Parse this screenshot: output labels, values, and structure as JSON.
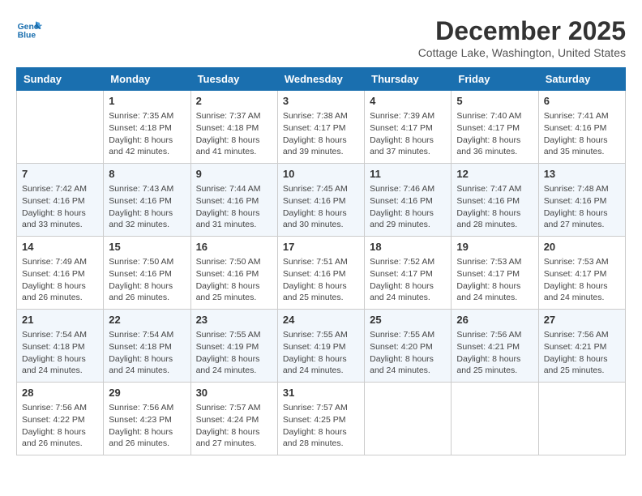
{
  "logo": {
    "line1": "General",
    "line2": "Blue"
  },
  "title": "December 2025",
  "location": "Cottage Lake, Washington, United States",
  "weekdays": [
    "Sunday",
    "Monday",
    "Tuesday",
    "Wednesday",
    "Thursday",
    "Friday",
    "Saturday"
  ],
  "weeks": [
    [
      {
        "day": "",
        "content": ""
      },
      {
        "day": "1",
        "content": "Sunrise: 7:35 AM\nSunset: 4:18 PM\nDaylight: 8 hours\nand 42 minutes."
      },
      {
        "day": "2",
        "content": "Sunrise: 7:37 AM\nSunset: 4:18 PM\nDaylight: 8 hours\nand 41 minutes."
      },
      {
        "day": "3",
        "content": "Sunrise: 7:38 AM\nSunset: 4:17 PM\nDaylight: 8 hours\nand 39 minutes."
      },
      {
        "day": "4",
        "content": "Sunrise: 7:39 AM\nSunset: 4:17 PM\nDaylight: 8 hours\nand 37 minutes."
      },
      {
        "day": "5",
        "content": "Sunrise: 7:40 AM\nSunset: 4:17 PM\nDaylight: 8 hours\nand 36 minutes."
      },
      {
        "day": "6",
        "content": "Sunrise: 7:41 AM\nSunset: 4:16 PM\nDaylight: 8 hours\nand 35 minutes."
      }
    ],
    [
      {
        "day": "7",
        "content": "Sunrise: 7:42 AM\nSunset: 4:16 PM\nDaylight: 8 hours\nand 33 minutes."
      },
      {
        "day": "8",
        "content": "Sunrise: 7:43 AM\nSunset: 4:16 PM\nDaylight: 8 hours\nand 32 minutes."
      },
      {
        "day": "9",
        "content": "Sunrise: 7:44 AM\nSunset: 4:16 PM\nDaylight: 8 hours\nand 31 minutes."
      },
      {
        "day": "10",
        "content": "Sunrise: 7:45 AM\nSunset: 4:16 PM\nDaylight: 8 hours\nand 30 minutes."
      },
      {
        "day": "11",
        "content": "Sunrise: 7:46 AM\nSunset: 4:16 PM\nDaylight: 8 hours\nand 29 minutes."
      },
      {
        "day": "12",
        "content": "Sunrise: 7:47 AM\nSunset: 4:16 PM\nDaylight: 8 hours\nand 28 minutes."
      },
      {
        "day": "13",
        "content": "Sunrise: 7:48 AM\nSunset: 4:16 PM\nDaylight: 8 hours\nand 27 minutes."
      }
    ],
    [
      {
        "day": "14",
        "content": "Sunrise: 7:49 AM\nSunset: 4:16 PM\nDaylight: 8 hours\nand 26 minutes."
      },
      {
        "day": "15",
        "content": "Sunrise: 7:50 AM\nSunset: 4:16 PM\nDaylight: 8 hours\nand 26 minutes."
      },
      {
        "day": "16",
        "content": "Sunrise: 7:50 AM\nSunset: 4:16 PM\nDaylight: 8 hours\nand 25 minutes."
      },
      {
        "day": "17",
        "content": "Sunrise: 7:51 AM\nSunset: 4:16 PM\nDaylight: 8 hours\nand 25 minutes."
      },
      {
        "day": "18",
        "content": "Sunrise: 7:52 AM\nSunset: 4:17 PM\nDaylight: 8 hours\nand 24 minutes."
      },
      {
        "day": "19",
        "content": "Sunrise: 7:53 AM\nSunset: 4:17 PM\nDaylight: 8 hours\nand 24 minutes."
      },
      {
        "day": "20",
        "content": "Sunrise: 7:53 AM\nSunset: 4:17 PM\nDaylight: 8 hours\nand 24 minutes."
      }
    ],
    [
      {
        "day": "21",
        "content": "Sunrise: 7:54 AM\nSunset: 4:18 PM\nDaylight: 8 hours\nand 24 minutes."
      },
      {
        "day": "22",
        "content": "Sunrise: 7:54 AM\nSunset: 4:18 PM\nDaylight: 8 hours\nand 24 minutes."
      },
      {
        "day": "23",
        "content": "Sunrise: 7:55 AM\nSunset: 4:19 PM\nDaylight: 8 hours\nand 24 minutes."
      },
      {
        "day": "24",
        "content": "Sunrise: 7:55 AM\nSunset: 4:19 PM\nDaylight: 8 hours\nand 24 minutes."
      },
      {
        "day": "25",
        "content": "Sunrise: 7:55 AM\nSunset: 4:20 PM\nDaylight: 8 hours\nand 24 minutes."
      },
      {
        "day": "26",
        "content": "Sunrise: 7:56 AM\nSunset: 4:21 PM\nDaylight: 8 hours\nand 25 minutes."
      },
      {
        "day": "27",
        "content": "Sunrise: 7:56 AM\nSunset: 4:21 PM\nDaylight: 8 hours\nand 25 minutes."
      }
    ],
    [
      {
        "day": "28",
        "content": "Sunrise: 7:56 AM\nSunset: 4:22 PM\nDaylight: 8 hours\nand 26 minutes."
      },
      {
        "day": "29",
        "content": "Sunrise: 7:56 AM\nSunset: 4:23 PM\nDaylight: 8 hours\nand 26 minutes."
      },
      {
        "day": "30",
        "content": "Sunrise: 7:57 AM\nSunset: 4:24 PM\nDaylight: 8 hours\nand 27 minutes."
      },
      {
        "day": "31",
        "content": "Sunrise: 7:57 AM\nSunset: 4:25 PM\nDaylight: 8 hours\nand 28 minutes."
      },
      {
        "day": "",
        "content": ""
      },
      {
        "day": "",
        "content": ""
      },
      {
        "day": "",
        "content": ""
      }
    ]
  ]
}
